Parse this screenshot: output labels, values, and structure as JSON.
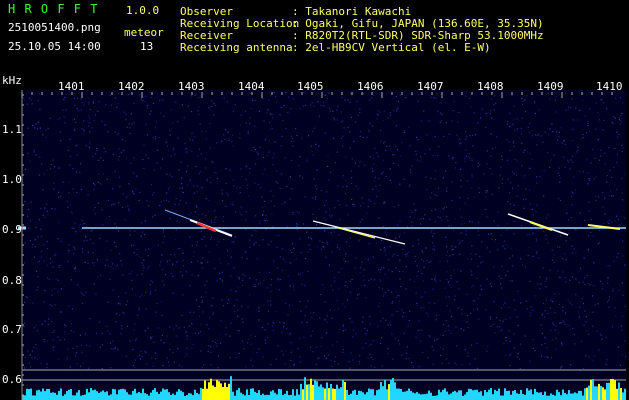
{
  "header": {
    "app_name": "H R O F F T",
    "version": "1.0.0",
    "filename": "2510051400.png",
    "meteor_label": "meteor",
    "datetime": "25.10.05 14:00",
    "meteor_count": "13",
    "info_labels": [
      "Observer",
      "Receiving Location",
      "Receiver",
      "Receiving antenna"
    ],
    "info_values": [
      ": Takanori Kawachi",
      ": Ogaki, Gifu, JAPAN (136.60E, 35.35N)",
      ": R820T2(RTL-SDR) SDR-Sharp 53.1000MHz",
      ": 2el-HB9CV Vertical (el. E-W)"
    ]
  },
  "spectrogram": {
    "y_unit": "kHz",
    "y_ticks": [
      "1.1",
      "1.0",
      "0.9",
      "0.8",
      "0.7",
      "0.6"
    ],
    "time_ticks": [
      "1401",
      "1402",
      "1403",
      "1404",
      "1405",
      "1406",
      "1407",
      "1408",
      "1409",
      "1410"
    ],
    "colors": {
      "background": "#000022",
      "carrier": "#9fd8ff",
      "meteor_hot": "#ff3333",
      "meteor": "#ffffff",
      "activity_bar": "#22d7ff",
      "activity_peak": "#ffff00"
    }
  }
}
